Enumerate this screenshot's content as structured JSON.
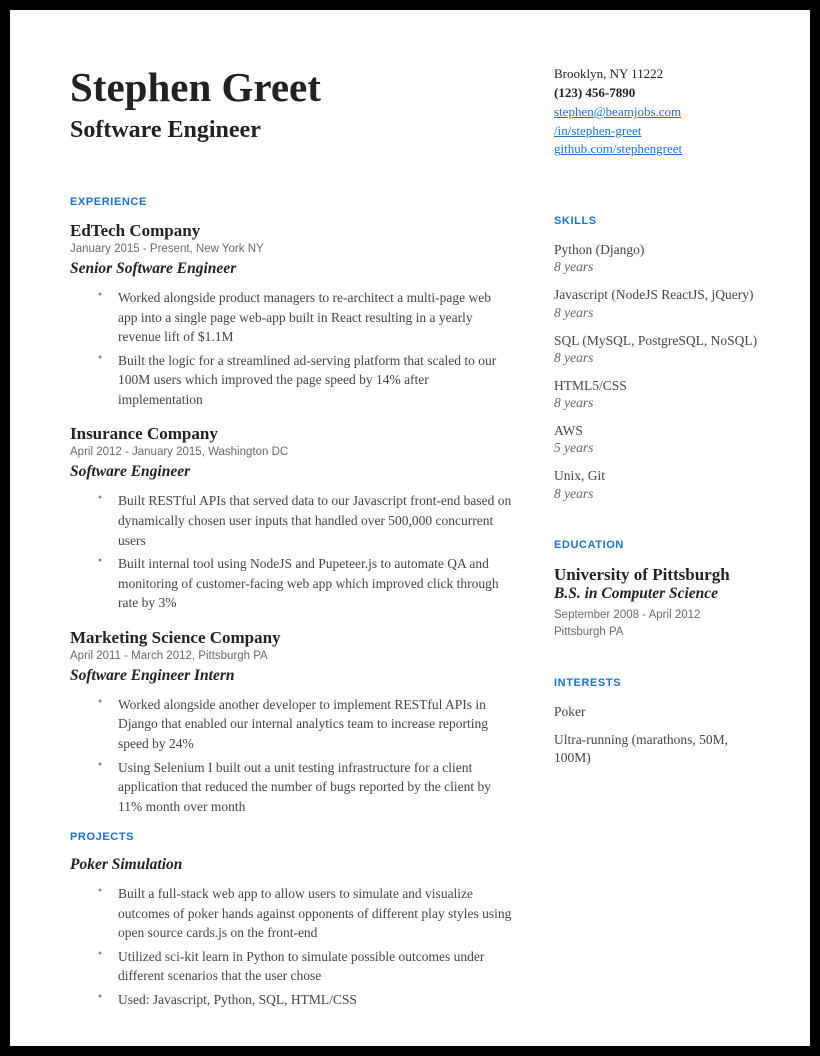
{
  "name": "Stephen Greet",
  "title": "Software Engineer",
  "contact": {
    "location": "Brooklyn, NY 11222",
    "phone": "(123) 456-7890",
    "email": "stephen@beamjobs.com",
    "linkedin": "/in/stephen-greet",
    "github": "github.com/stephengreet"
  },
  "sections": {
    "experience_hdr": "EXPERIENCE",
    "projects_hdr": "PROJECTS",
    "skills_hdr": "SKILLS",
    "education_hdr": "EDUCATION",
    "interests_hdr": "INTERESTS"
  },
  "experience": [
    {
      "company": "EdTech Company",
      "dates": "January 2015 - Present, New York NY",
      "role": "Senior Software Engineer",
      "bullets": [
        "Worked alongside product managers to re-architect a multi-page web app into a single page web-app built in React resulting in a yearly revenue lift of $1.1M",
        "Built the logic for  a streamlined ad-serving platform that scaled to our 100M users which improved the page speed by 14% after implementation"
      ]
    },
    {
      "company": "Insurance Company",
      "dates": "April 2012 - January 2015, Washington DC",
      "role": "Software Engineer",
      "bullets": [
        "Built RESTful APIs that served data to our Javascript front-end based on dynamically chosen user inputs that handled over 500,000 concurrent users",
        "Built internal tool using NodeJS and Pupeteer.js to automate QA and monitoring of customer-facing web app which improved click through rate by 3%"
      ]
    },
    {
      "company": "Marketing Science Company",
      "dates": "April 2011 - March 2012, Pittsburgh PA",
      "role": "Software Engineer Intern",
      "bullets": [
        "Worked alongside another developer to implement RESTful APIs in Django that enabled our internal analytics team to increase reporting speed by 24%",
        "Using Selenium I built out a unit testing infrastructure for a client application that reduced the number of bugs reported by the client by 11% month over month"
      ]
    }
  ],
  "projects": [
    {
      "name": "Poker Simulation",
      "bullets": [
        "Built a full-stack web app to allow users to simulate and visualize outcomes of poker hands against opponents of different play styles using open source cards.js on the front-end",
        "Utilized  sci-kit learn in Python to simulate possible outcomes under different scenarios that the user chose",
        "Used: Javascript, Python, SQL, HTML/CSS"
      ]
    }
  ],
  "skills": [
    {
      "name": "Python (Django)",
      "duration": "8 years"
    },
    {
      "name": "Javascript (NodeJS ReactJS, jQuery)",
      "duration": "8 years"
    },
    {
      "name": "SQL  (MySQL, PostgreSQL, NoSQL)",
      "duration": "8 years"
    },
    {
      "name": "HTML5/CSS",
      "duration": "8 years"
    },
    {
      "name": "AWS",
      "duration": "5 years"
    },
    {
      "name": "Unix, Git",
      "duration": "8 years"
    }
  ],
  "education": {
    "school": "University of Pittsburgh",
    "degree": "B.S. in Computer Science",
    "dates": "September 2008 - April 2012",
    "location": "Pittsburgh PA"
  },
  "interests": [
    "Poker",
    "Ultra-running (marathons, 50M, 100M)"
  ]
}
